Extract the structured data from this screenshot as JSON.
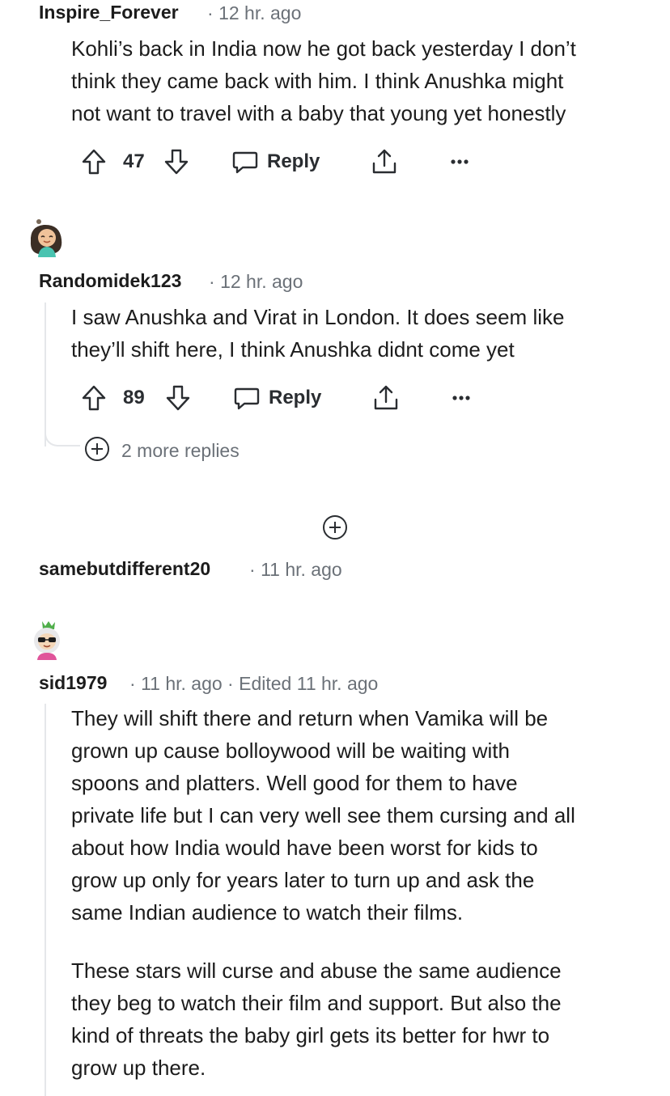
{
  "comments": [
    {
      "author": "Inspire_Forever",
      "meta": "12 hr. ago",
      "body": [
        "Kohli’s back in India now he got back yesterday I don’t",
        "think they came back with him. I think Anushka might",
        "not want to travel with a baby that young yet honestly"
      ],
      "score": "47",
      "reply_label": "Reply"
    },
    {
      "author": "Randomidek123",
      "meta": "12 hr. ago",
      "body": [
        "I saw Anushka and Virat in London. It does seem like",
        "they’ll shift here, I think Anushka didnt come yet"
      ],
      "score": "89",
      "reply_label": "Reply",
      "more_replies": "2 more replies"
    },
    {
      "author": "samebutdifferent20",
      "meta": "11 hr. ago"
    },
    {
      "author": "sid1979",
      "meta": "11 hr. ago",
      "edited": "Edited 11 hr. ago",
      "paragraphs": [
        [
          "They will shift there and return when Vamika will be",
          "grown up cause bolloywood will be waiting with",
          "spoons and platters. Well good for them to have",
          "private life but I can very well see them cursing and all",
          "about how India would have been worst for kids to",
          "grow up only for years later to turn up and ask the",
          "same Indian audience to watch their films."
        ],
        [
          "These stars will curse and abuse the same audience",
          "they beg to watch their film and support. But also the",
          "kind of threats the baby girl gets its better for hwr to",
          "grow up there."
        ]
      ]
    }
  ],
  "icons": {
    "upvote": "upvote-arrow-icon",
    "downvote": "downvote-arrow-icon",
    "reply": "speech-bubble-icon",
    "share": "share-upload-icon",
    "more": "ellipsis-icon",
    "expand": "plus-circle-icon"
  },
  "colors": {
    "text": "#1c1c1c",
    "meta": "#6b7178",
    "thread_line": "#e5e7ea"
  }
}
